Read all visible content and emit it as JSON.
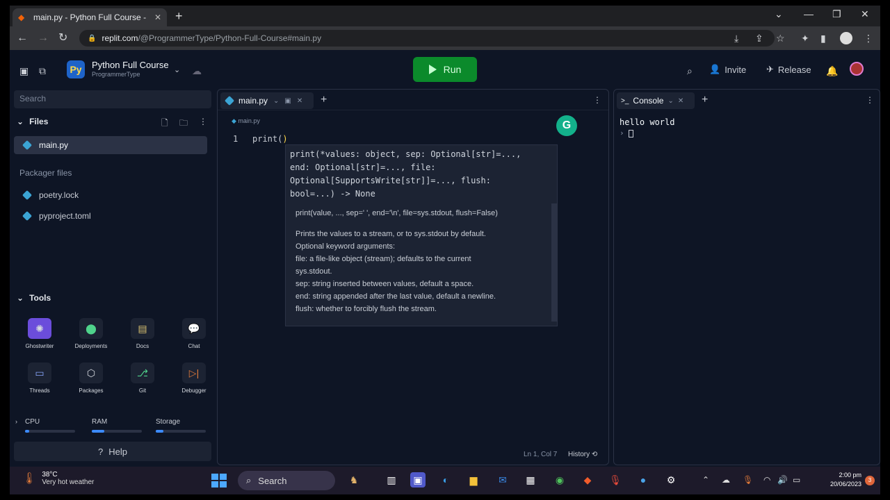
{
  "browser": {
    "tab_title": "main.py - Python Full Course - Re",
    "url_host": "replit.com",
    "url_path": "/@ProgrammerType/Python-Full-Course#main.py"
  },
  "header": {
    "repl_name": "Python Full Course",
    "owner": "ProgrammerType",
    "run_label": "Run",
    "invite_label": "Invite",
    "release_label": "Release"
  },
  "sidebar": {
    "search_placeholder": "Search",
    "files_heading": "Files",
    "files": [
      {
        "label": "main.py"
      }
    ],
    "packager_heading": "Packager files",
    "packager_files": [
      {
        "label": "poetry.lock"
      },
      {
        "label": "pyproject.toml"
      }
    ],
    "tools_heading": "Tools",
    "tools": [
      {
        "label": "Ghostwriter"
      },
      {
        "label": "Deployments"
      },
      {
        "label": "Docs"
      },
      {
        "label": "Chat"
      },
      {
        "label": "Threads"
      },
      {
        "label": "Packages"
      },
      {
        "label": "Git"
      },
      {
        "label": "Debugger"
      }
    ],
    "meters": [
      {
        "label": "CPU",
        "level": 0.08
      },
      {
        "label": "RAM",
        "level": 0.25
      },
      {
        "label": "Storage",
        "level": 0.15
      }
    ],
    "help_label": "Help"
  },
  "editor": {
    "tab_label": "main.py",
    "breadcrumb": "main.py",
    "line_number": "1",
    "code_prefix": "print(",
    "code_paren": ")",
    "cursor_pos": "Ln 1, Col 7",
    "history_label": "History"
  },
  "popup": {
    "sig_1": "print(*values: object, sep: Optional[str]=...,",
    "sig_2": "end: Optional[str]=..., file:",
    "sig_3": "Optional[SupportsWrite[str]]=..., flush:",
    "sig_4": "bool=...) -> None",
    "doc_sig": "print(value, ..., sep=' ', end='\\n', file=sys.stdout, flush=False)",
    "doc_lines": [
      "Prints the values to a stream, or to sys.stdout by default.",
      "Optional keyword arguments:",
      "file:  a file-like object (stream); defaults to the current",
      "sys.stdout.",
      "sep:   string inserted between values, default a space.",
      "end:   string appended after the last value, default a newline.",
      "flush: whether to forcibly flush the stream."
    ]
  },
  "console": {
    "tab_label": "Console",
    "output": "hello world",
    "prompt": "›"
  },
  "taskbar": {
    "temp": "38°C",
    "weather": "Very hot weather",
    "search_label": "Search",
    "time": "2:00 pm",
    "date": "20/06/2023"
  },
  "colors": {
    "run_green": "#0b8a2b",
    "bg": "#0e1525",
    "panel": "#1c2333"
  }
}
